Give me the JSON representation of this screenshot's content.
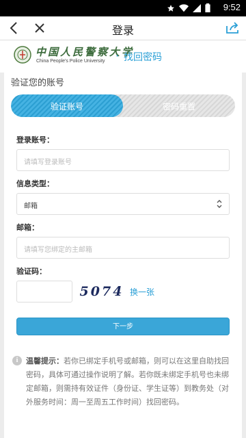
{
  "status_bar": {
    "time": "9:52",
    "icons": [
      "star-icon",
      "wifi-icon",
      "signal-icon",
      "battery-icon"
    ]
  },
  "top_bar": {
    "title": "登录",
    "icons": [
      "back-chevron-icon",
      "close-icon",
      "share-icon"
    ]
  },
  "header": {
    "logo_cn": "中国人民警察大学",
    "logo_en": "China People's Police University",
    "separator": "·",
    "subtitle": "找回密码"
  },
  "section_title": "验证您的账号",
  "steps": [
    {
      "label": "验证账号",
      "active": true
    },
    {
      "label": "密码重置",
      "active": false
    }
  ],
  "form": {
    "account": {
      "label": "登录账号：",
      "placeholder": "请填写登录账号"
    },
    "info_type": {
      "label": "信息类型：",
      "value": "邮箱"
    },
    "email": {
      "label": "邮箱：",
      "placeholder": "请填写您绑定的主邮箱"
    },
    "captcha": {
      "label": "验证码：",
      "image_text": "5074",
      "refresh_label": "换一张"
    },
    "submit_label": "下一步"
  },
  "tip": {
    "title": "温馨提示：",
    "text": "若你已绑定手机号或邮箱，则可以在这里自助找回密码，具体可通过操作说明了解。若你既未绑定手机号也未绑定邮箱，则需持有效证件（身份证、学生证等）到教务处（对外服务时间：周一至周五工作时间）找回密码。"
  },
  "colors": {
    "accent": "#2a9fd6",
    "button": "#3aa6d8",
    "background": "#ececec"
  }
}
